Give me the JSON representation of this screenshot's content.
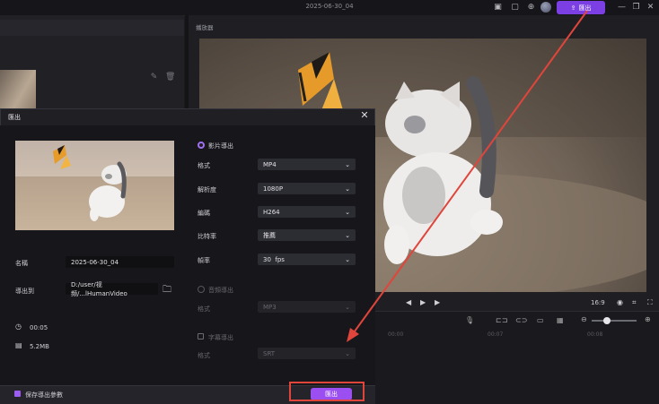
{
  "window": {
    "title": "2025-06-30_04",
    "export_button": "匯出"
  },
  "player": {
    "label": "播放器",
    "aspect": "16:9"
  },
  "timeline": {
    "ticks": [
      "00:00",
      "00:07",
      "00:08"
    ]
  },
  "dialog": {
    "title": "匯出",
    "name_label": "名稱",
    "name_value": "2025-06-30_04",
    "export_to_label": "導出到",
    "export_path": "D:/user/视频/...lHumanVideo",
    "duration": "00:05",
    "size": "5.2MB",
    "video_section": {
      "label": "影片導出",
      "format_label": "格式",
      "format_value": "MP4",
      "resolution_label": "解析度",
      "resolution_value": "1080P",
      "encoder_label": "編碼",
      "encoder_value": "H264",
      "bitrate_label": "比特率",
      "bitrate_value": "推薦",
      "framerate_label": "幀率",
      "framerate_value": "30  fps"
    },
    "audio_section": {
      "label": "音頻導出",
      "format_label": "格式",
      "format_value": "MP3"
    },
    "subtitle_section": {
      "label": "字幕導出",
      "format_label": "格式",
      "format_value": "SRT"
    },
    "save_params_label": "保存導出參數",
    "export_button": "匯出"
  },
  "colors": {
    "accent": "#9b4ff0",
    "highlight": "#e0453c"
  }
}
